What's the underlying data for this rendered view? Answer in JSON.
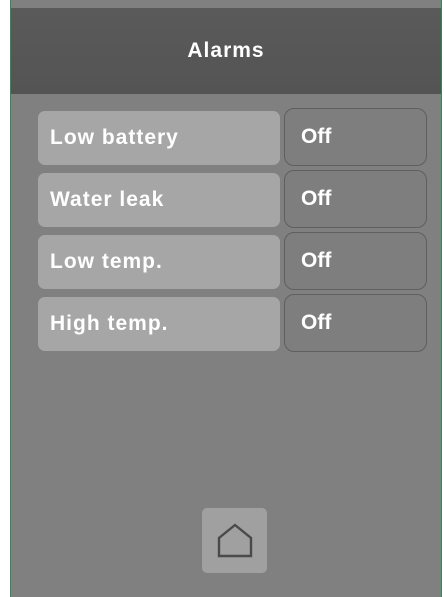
{
  "header": {
    "title": "Alarms"
  },
  "alarms": [
    {
      "label": "Low battery",
      "state": "Off"
    },
    {
      "label": "Water leak",
      "state": "Off"
    },
    {
      "label": "Low temp.",
      "state": "Off"
    },
    {
      "label": "High temp.",
      "state": "Off"
    }
  ],
  "footer": {
    "home_icon": "home-icon"
  },
  "colors": {
    "background": "#808080",
    "header": "#565656",
    "label_bg": "#a6a6a6",
    "toggle_bg": "#7e7e7e",
    "text": "#ffffff"
  }
}
